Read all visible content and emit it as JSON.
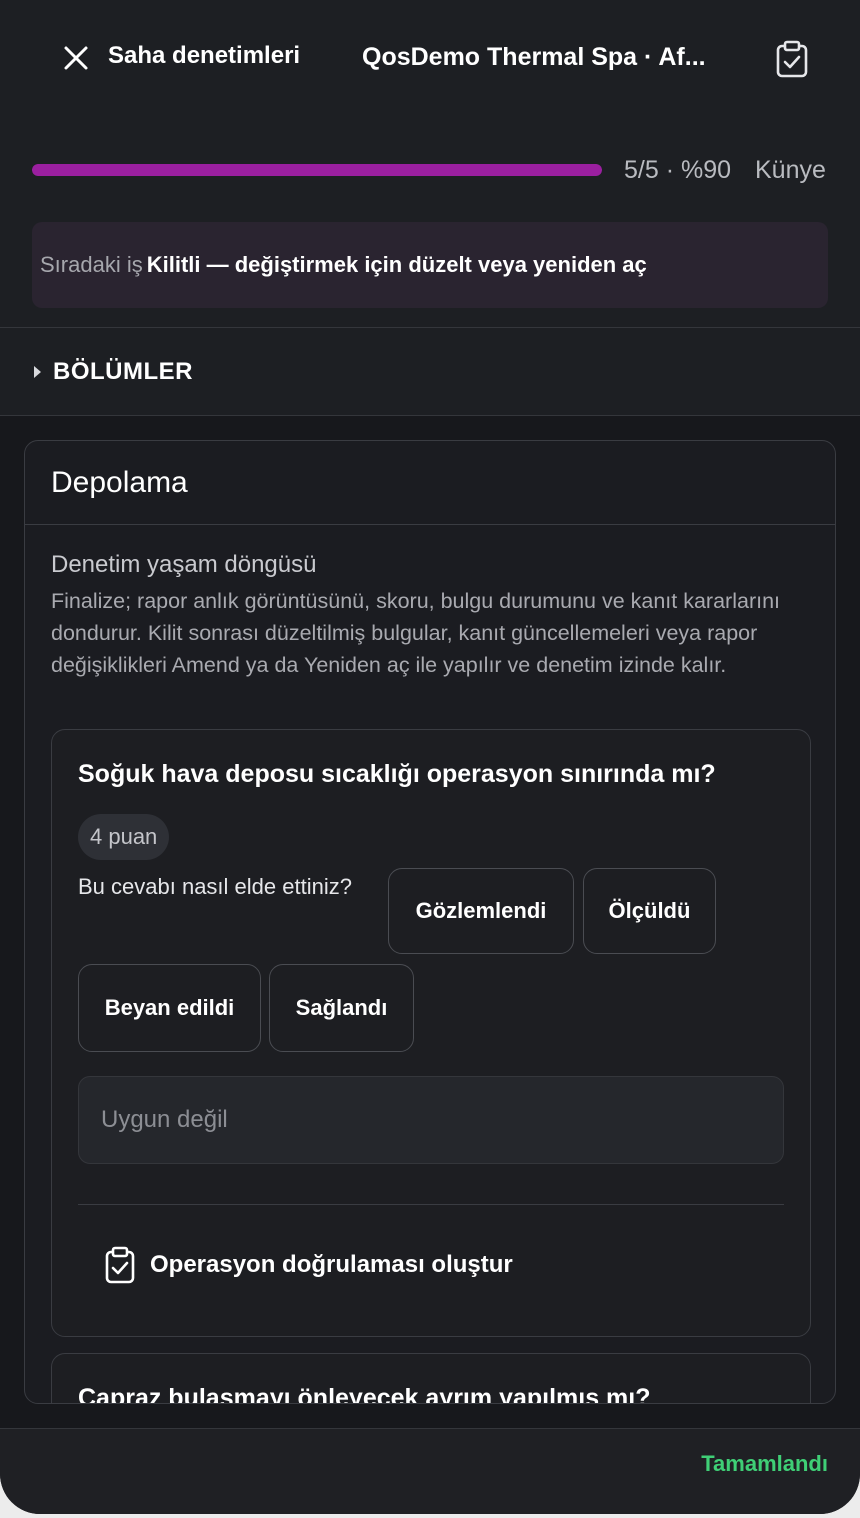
{
  "header": {
    "back_label": "Saha denetimleri",
    "title": "QosDemo Thermal Spa · Af...",
    "close_icon": "close-icon",
    "clipboard_icon": "clipboard-check-icon"
  },
  "progress": {
    "fraction": 1.0,
    "text": "5/5 · %90",
    "kunye_label": "Künye",
    "fill_color": "#9b1fa0"
  },
  "next_task": {
    "prefix": "Sıradaki iş",
    "value": "Kilitli — değiştirmek için düzelt veya yeniden aç"
  },
  "sections_toggle": {
    "label": "BÖLÜMLER"
  },
  "section": {
    "title": "Depolama",
    "lifecycle_title": "Denetim yaşam döngüsü",
    "lifecycle_body": "Finalize; rapor anlık görüntüsünü, skoru, bulgu durumunu ve kanıt kararlarını dondurur. Kilit sonrası düzeltilmiş bulgular, kanıt güncellemeleri veya rapor değişiklikleri Amend ya da Yeniden aç ile yapılır ve denetim izinde kalır."
  },
  "question": {
    "title": "Soğuk hava deposu sıcaklığı operasyon sınırında mı?",
    "points": "4 puan",
    "how_label": "Bu cevabı nasıl elde ettiniz?",
    "options": [
      "Gözlemlendi",
      "Ölçüldü",
      "Beyan edildi",
      "Sağlandı"
    ],
    "na_placeholder": "Uygun değil",
    "verify_label": "Operasyon doğrulaması oluştur"
  },
  "question_2": {
    "title": "Çapraz bulaşmayı önleyecek ayrım yapılmış mı?"
  },
  "footer": {
    "done_label": "Tamamlandı",
    "done_color": "#3fcf76"
  }
}
